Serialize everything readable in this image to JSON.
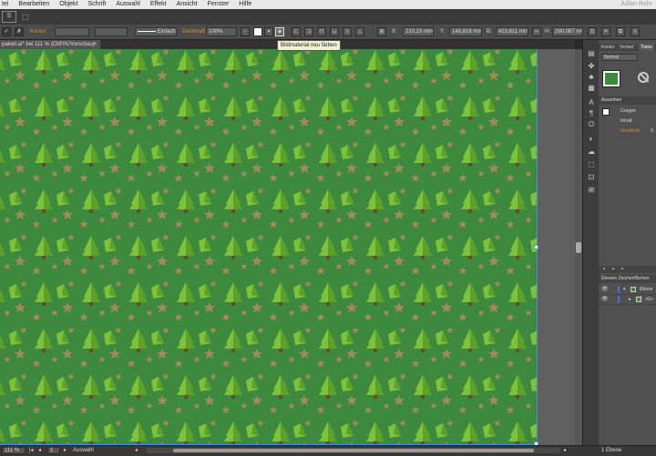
{
  "menubar": {
    "items": [
      "tei",
      "Bearbeiten",
      "Objekt",
      "Schrift",
      "Auswahl",
      "Effekt",
      "Ansicht",
      "Fenster",
      "Hilfe"
    ],
    "user": "Julian Rohr"
  },
  "control_bar": {
    "kontur_label": "Kontur",
    "stroke_style": "Einfach",
    "deckkraft_label": "Deckkraft",
    "opacity": "100%",
    "x_value": "210,23 mm",
    "y_value": "148,818 mm",
    "w_value": "423,611 mm",
    "h_value": "290,067 mm",
    "tooltip": "Bildmaterial neu färben"
  },
  "document_tab": {
    "title": "paketl.ai* bei 111 % (CMYK/Vorschau)",
    "close": "×"
  },
  "right_panel": {
    "tabs": [
      "Kontur",
      "Verlauf",
      "Trans"
    ],
    "blend_mode": "Normal",
    "appearance_header": "Aussehen",
    "appearance_rows": [
      "Gruppe",
      "Inhalt",
      "Deckkraft"
    ],
    "appearance_suffix": "S",
    "layers_tabs": "Ebenen   Zeichenflächen",
    "layers": [
      {
        "name": "Ebene 1"
      },
      {
        "name": "<Gr"
      }
    ],
    "layers_footer": "1 Ebene"
  },
  "status_bar": {
    "zoom": "111 %",
    "page": "1",
    "mode": "Auswahl"
  },
  "colors": {
    "artboard": "#3d8a3e",
    "tree": "#7dc23b",
    "tree_dark": "#5ea12a",
    "trunk": "#6b4a2a",
    "star": "#a38a5a",
    "accent": "#e08a2e"
  }
}
